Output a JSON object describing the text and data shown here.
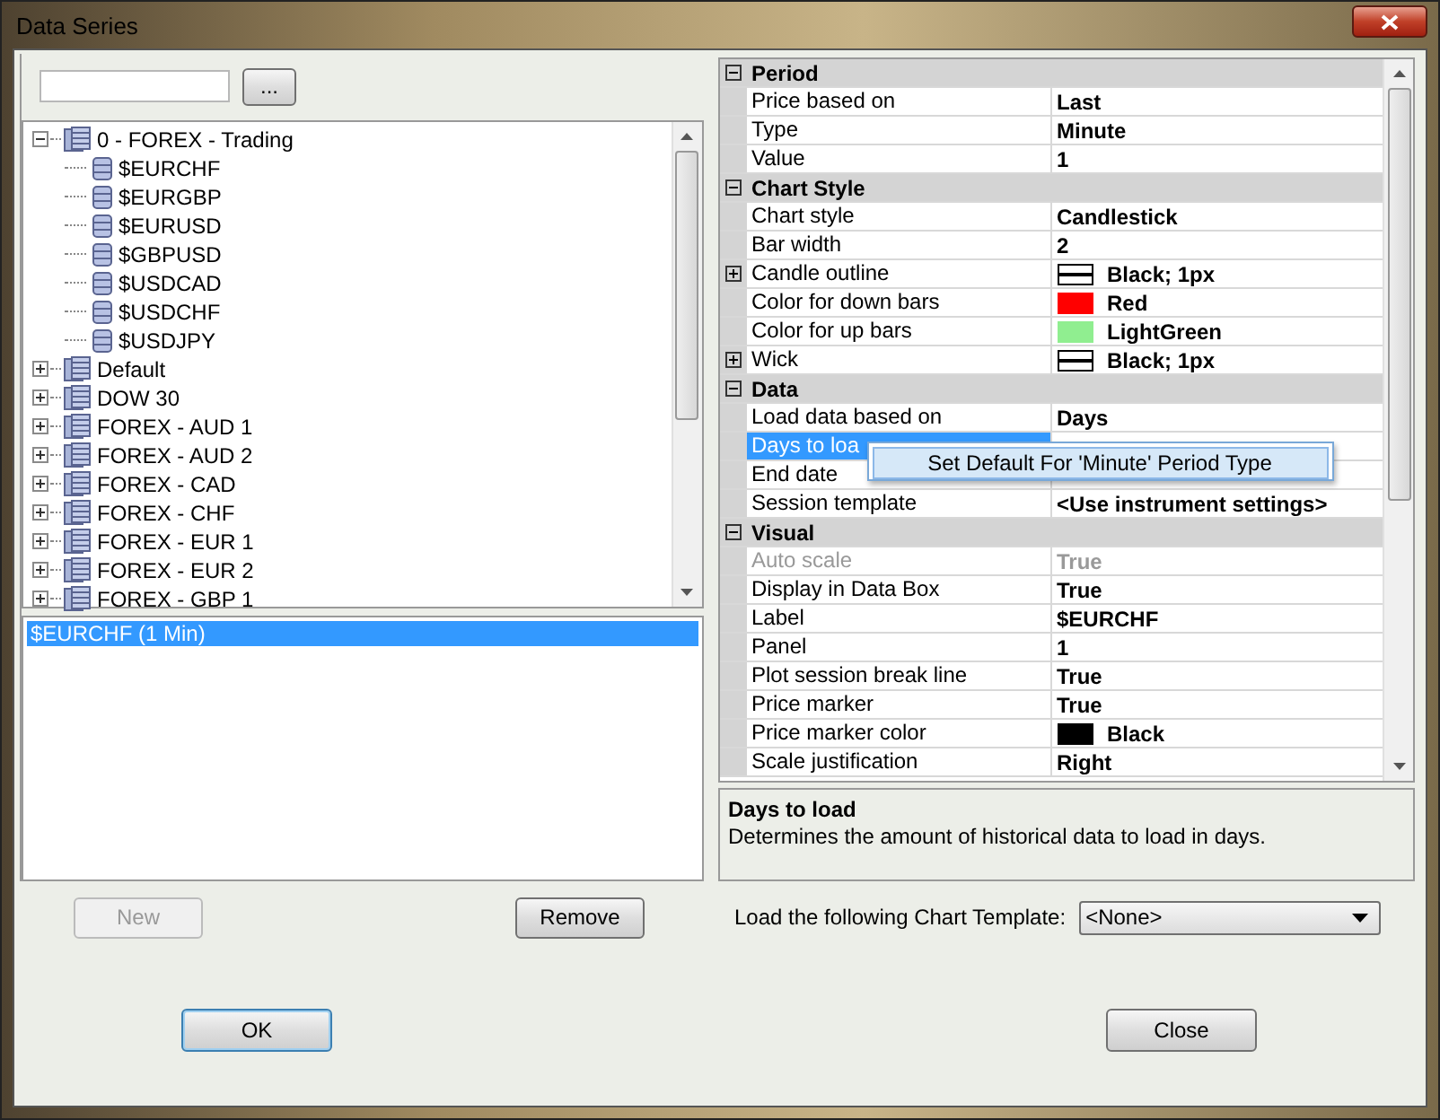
{
  "window": {
    "title": "Data Series"
  },
  "search": {
    "browse_button": "..."
  },
  "tree": [
    {
      "label": "0 - FOREX - Trading",
      "kind": "group",
      "expanded": true,
      "children": [
        {
          "label": "$EURCHF",
          "kind": "instrument"
        },
        {
          "label": "$EURGBP",
          "kind": "instrument"
        },
        {
          "label": "$EURUSD",
          "kind": "instrument"
        },
        {
          "label": "$GBPUSD",
          "kind": "instrument"
        },
        {
          "label": "$USDCAD",
          "kind": "instrument"
        },
        {
          "label": "$USDCHF",
          "kind": "instrument"
        },
        {
          "label": "$USDJPY",
          "kind": "instrument"
        }
      ]
    },
    {
      "label": "Default",
      "kind": "group",
      "expanded": false
    },
    {
      "label": "DOW 30",
      "kind": "group",
      "expanded": false
    },
    {
      "label": "FOREX - AUD 1",
      "kind": "group",
      "expanded": false
    },
    {
      "label": "FOREX - AUD 2",
      "kind": "group",
      "expanded": false
    },
    {
      "label": "FOREX - CAD",
      "kind": "group",
      "expanded": false
    },
    {
      "label": "FOREX - CHF",
      "kind": "group",
      "expanded": false
    },
    {
      "label": "FOREX - EUR 1",
      "kind": "group",
      "expanded": false
    },
    {
      "label": "FOREX - EUR 2",
      "kind": "group",
      "expanded": false
    },
    {
      "label": "FOREX - GBP 1",
      "kind": "group",
      "expanded": false
    }
  ],
  "series_list": [
    {
      "label": "$EURCHF (1 Min)",
      "selected": true
    }
  ],
  "buttons_left": [
    {
      "label": "New",
      "disabled": true
    },
    {
      "label": "Remove",
      "disabled": false
    }
  ],
  "properties": [
    {
      "kind": "category",
      "label": "Period",
      "expanded": true
    },
    {
      "kind": "property",
      "label": "Price based on",
      "value": "Last"
    },
    {
      "kind": "property",
      "label": "Type",
      "value": "Minute"
    },
    {
      "kind": "property",
      "label": "Value",
      "value": "1"
    },
    {
      "kind": "category",
      "label": "Chart Style",
      "expanded": true
    },
    {
      "kind": "property",
      "label": "Chart style",
      "value": "Candlestick"
    },
    {
      "kind": "property",
      "label": "Bar width",
      "value": "2"
    },
    {
      "kind": "pen_property",
      "label": "Candle outline",
      "value": "Black; 1px",
      "expandable": true
    },
    {
      "kind": "color_property",
      "label": "Color for down bars",
      "value": "Red",
      "color": "#ff0000"
    },
    {
      "kind": "color_property",
      "label": "Color for up bars",
      "value": "LightGreen",
      "color": "#90ee90"
    },
    {
      "kind": "pen_property",
      "label": "Wick",
      "value": "Black; 1px",
      "expandable": true
    },
    {
      "kind": "category",
      "label": "Data",
      "expanded": true
    },
    {
      "kind": "property",
      "label": "Load data based on",
      "value": "Days"
    },
    {
      "kind": "property",
      "label": "Days to loa",
      "selected": true
    },
    {
      "kind": "property",
      "label": "End date",
      "selected": false
    },
    {
      "kind": "property",
      "label": "Session template",
      "value": "<Use instrument settings>"
    },
    {
      "kind": "category",
      "label": "Visual",
      "expanded": true
    },
    {
      "kind": "property",
      "label": "Auto scale",
      "value": "True",
      "disabled": true
    },
    {
      "kind": "property",
      "label": "Display in Data Box",
      "value": "True"
    },
    {
      "kind": "property",
      "label": "Label",
      "value": "$EURCHF"
    },
    {
      "kind": "property",
      "label": "Panel",
      "value": "1"
    },
    {
      "kind": "property",
      "label": "Plot session break line",
      "value": "True"
    },
    {
      "kind": "property",
      "label": "Price marker",
      "value": "True"
    },
    {
      "kind": "color_property",
      "label": "Price marker color",
      "value": "Black",
      "color": "#000000"
    },
    {
      "kind": "property",
      "label": "Scale justification",
      "value": "Right"
    }
  ],
  "context_menu": {
    "items": [
      "Set Default For 'Minute' Period Type"
    ]
  },
  "description": {
    "title": "Days to load",
    "text": "Determines the amount of historical data to load in days."
  },
  "template": {
    "label": "Load the following Chart Template:",
    "value": "<None>"
  },
  "buttons_bottom": [
    "OK",
    "Close"
  ]
}
